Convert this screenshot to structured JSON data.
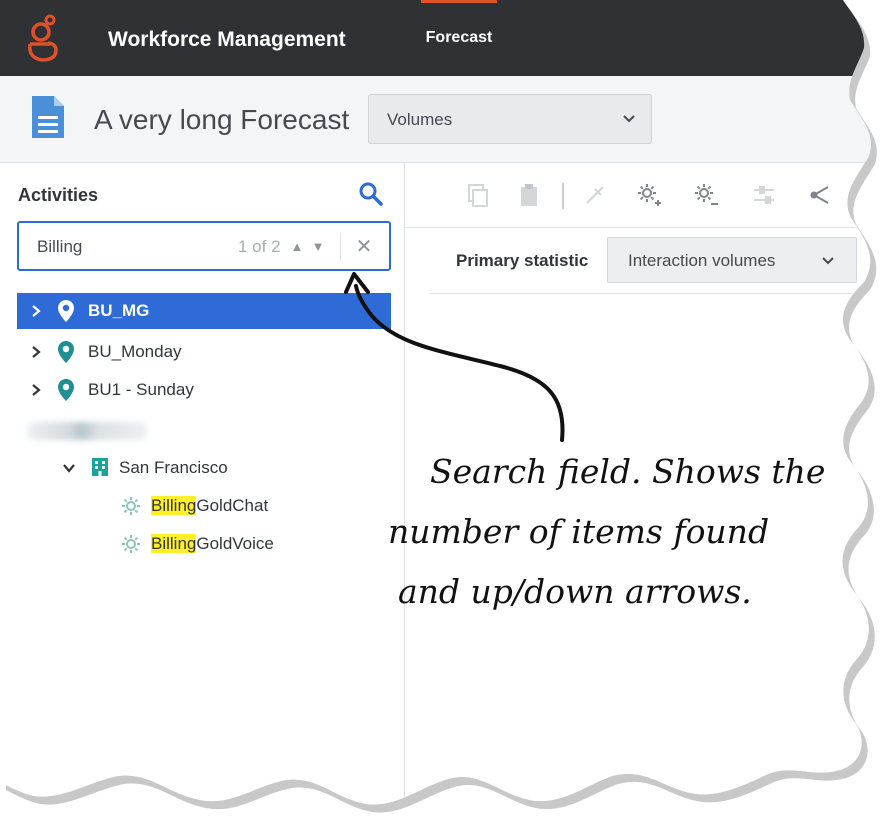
{
  "app": {
    "title": "Workforce Management",
    "nav_active": "Forecast"
  },
  "header": {
    "forecast_name": "A very long Forecast",
    "view_select": "Volumes"
  },
  "activities": {
    "label": "Activities",
    "search": {
      "value": "Billing",
      "result_count": "1 of 2"
    },
    "tree": [
      {
        "label": "BU_MG",
        "selected": true
      },
      {
        "label": "BU_Monday",
        "selected": false
      },
      {
        "label": "BU1 - Sunday",
        "selected": false
      }
    ],
    "site": "San Francisco",
    "activities_list": [
      {
        "match": "Billing",
        "rest": "GoldChat"
      },
      {
        "match": "Billing",
        "rest": "GoldVoice"
      }
    ]
  },
  "right": {
    "primary_statistic_label": "Primary statistic",
    "primary_statistic_value": "Interaction volumes"
  },
  "annotation": {
    "lines": [
      "Search field. Shows the",
      "number of items found",
      "and up/down arrows."
    ]
  },
  "colors": {
    "accent": "#2e6bd6",
    "brand": "#e0512a",
    "topbar": "#2f3134",
    "pin": "#1f8f94",
    "highlight": "#fff02a"
  }
}
